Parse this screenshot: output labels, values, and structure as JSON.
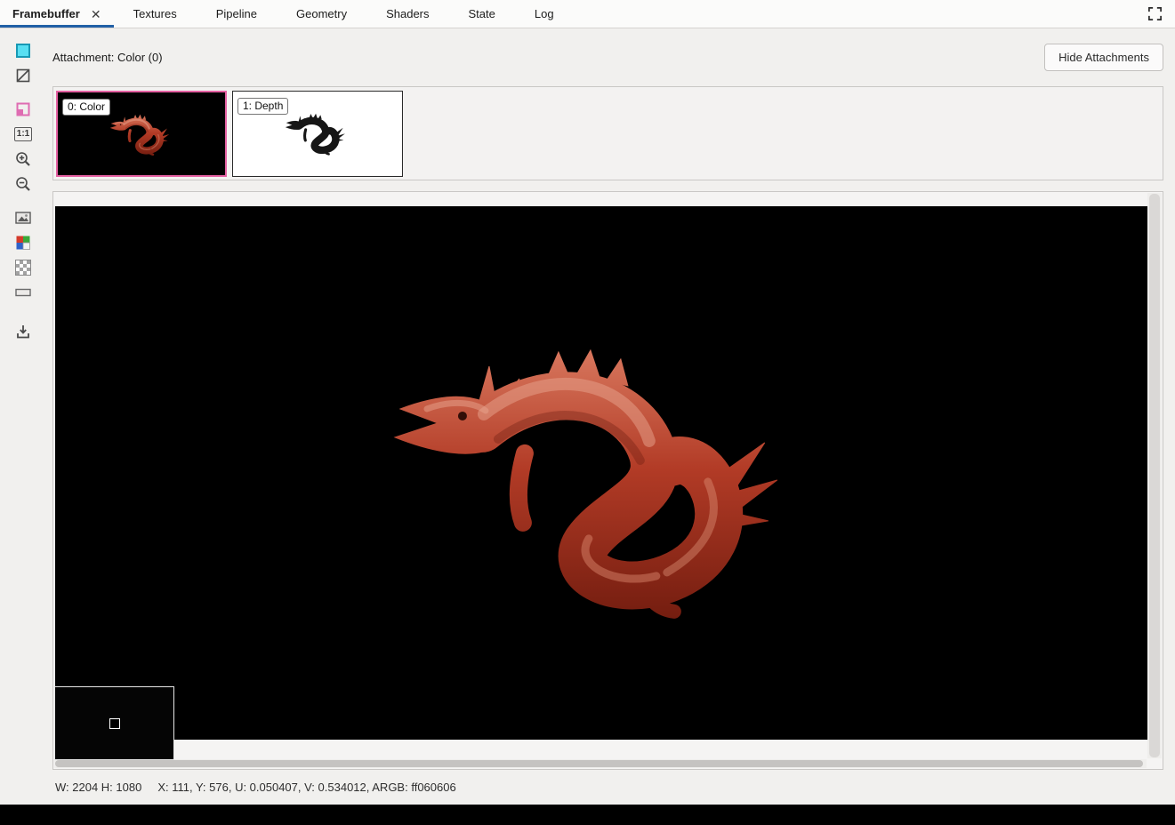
{
  "tab_bar": {
    "tabs": [
      {
        "label": "Framebuffer",
        "active": true,
        "close_icon": "✕"
      },
      {
        "label": "Textures"
      },
      {
        "label": "Pipeline"
      },
      {
        "label": "Geometry"
      },
      {
        "label": "Shaders"
      },
      {
        "label": "State"
      },
      {
        "label": "Log"
      }
    ],
    "fullscreen_icon": "expand-corners"
  },
  "toolbar": {
    "icons": [
      "color-swatch-icon",
      "alpha-disabled-icon",
      "pink-border-icon",
      "zoom-actual-icon",
      "zoom-in-icon",
      "zoom-out-icon",
      "fit-image-icon",
      "rgba-channels-icon",
      "checkerboard-background-icon",
      "range-bar-icon",
      "save-texture-icon"
    ],
    "zoom_actual_label": "1:1"
  },
  "attachments": {
    "header_label": "Attachment: Color (0)",
    "hide_button_label": "Hide Attachments",
    "thumbnails": [
      {
        "label": "0: Color",
        "selected": true,
        "background": "#000000"
      },
      {
        "label": "1: Depth",
        "selected": false,
        "background": "#ffffff"
      }
    ]
  },
  "status_bar": {
    "size_text": "W: 2204 H: 1080",
    "pixel_text": "X: 111, Y: 576, U: 0.050407, V: 0.534012, ARGB: ff060606"
  },
  "colors": {
    "tab_accent": "#2160a6",
    "selected_thumb_border": "#e560a2",
    "dragon_red": "#b23b26",
    "preview_background": "#000000"
  }
}
